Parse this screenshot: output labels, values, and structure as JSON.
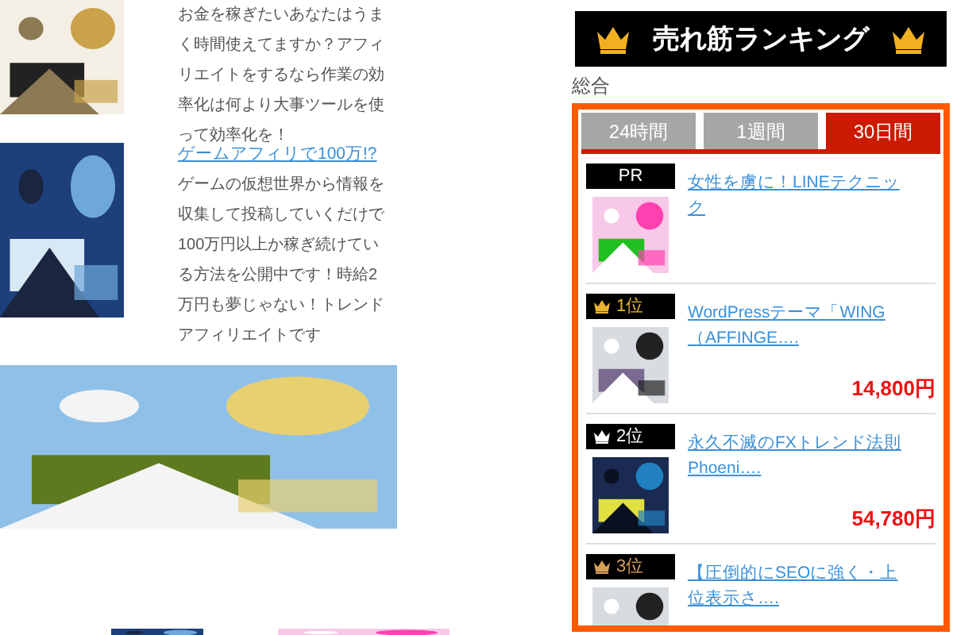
{
  "articles": [
    {
      "kind": "picture",
      "description": "お金を稼ぎたいあなたはうまく時間使えてますか？アフィリエイトをするなら作業の効率化は何より大事ツールを使って効率化を！"
    },
    {
      "kind": "picture",
      "title": "ゲームアフィリで100万!?",
      "description": "ゲームの仮想世界から情報を収集して投稿していくだけで100万円以上か稼ぎ続けている方法を公開中です！時給2万円も夢じゃない！トレンドアフィリエイトです"
    }
  ],
  "ranking": {
    "title": "売れ筋ランキング",
    "category": "総合",
    "tabs": [
      {
        "label": "24時間",
        "selected": false
      },
      {
        "label": "1週間",
        "selected": false
      },
      {
        "label": "30日間",
        "selected": true
      }
    ],
    "items": [
      {
        "kind": "pr",
        "badge": "PR",
        "title": "女性を虜に！LINEテクニック"
      },
      {
        "kind": "ranked",
        "badge": "1位",
        "color": "#e8b530",
        "title": "WordPressテーマ「WING（AFFINGE….",
        "price": "14,800円"
      },
      {
        "kind": "ranked",
        "badge": "2位",
        "color": "#ffffff",
        "title": "永久不滅のFXトレンド法則Phoeni….",
        "price": "54,780円"
      },
      {
        "kind": "ranked",
        "badge": "3位",
        "color": "#d9a05a",
        "title": "【圧倒的にSEOに強く・上位表示さ…."
      }
    ]
  }
}
